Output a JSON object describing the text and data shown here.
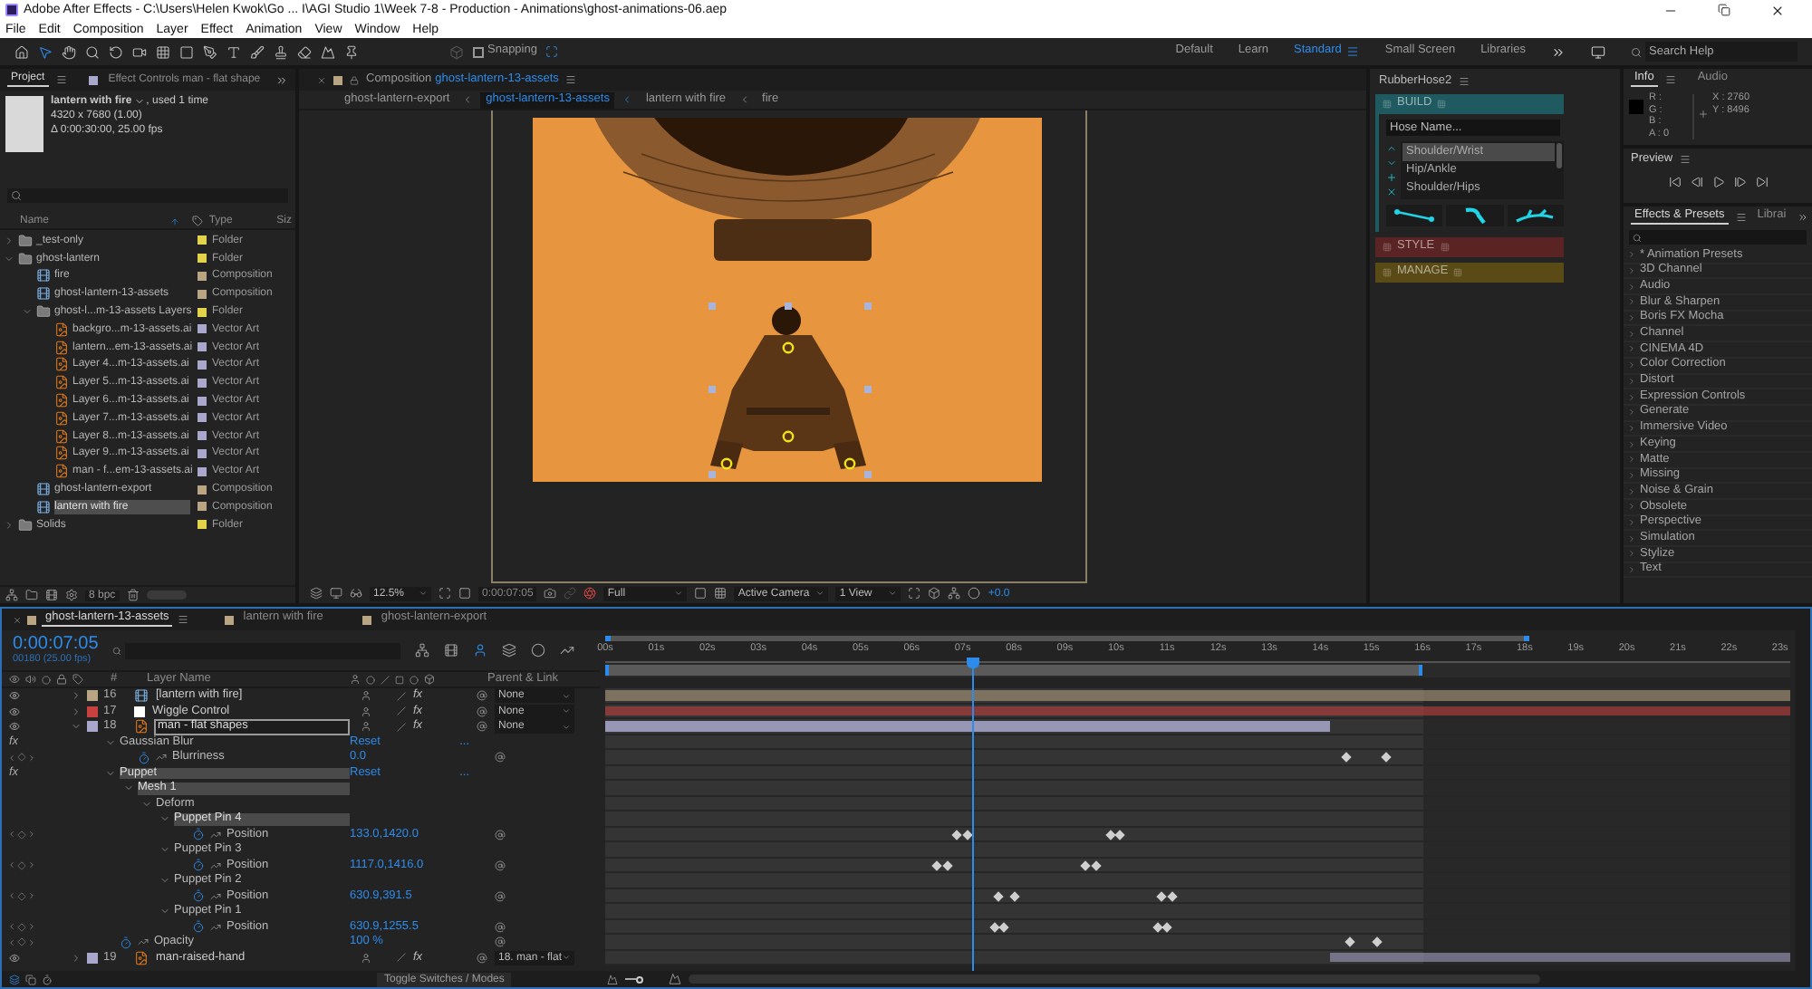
{
  "window": {
    "title": "Adobe After Effects - C:\\Users\\Helen Kwok\\Go ... I\\AGI Studio 1\\Week 7-8 - Production - Animations\\ghost-animations-06.aep"
  },
  "menu": [
    "File",
    "Edit",
    "Composition",
    "Layer",
    "Effect",
    "Animation",
    "View",
    "Window",
    "Help"
  ],
  "toolbar": {
    "snapping": {
      "label": "Snapping",
      "checked": false
    },
    "workspaces": [
      {
        "label": "Default",
        "selected": false
      },
      {
        "label": "Learn",
        "selected": false
      },
      {
        "label": "Standard",
        "selected": true
      },
      {
        "label": "Small Screen",
        "selected": false
      },
      {
        "label": "Libraries",
        "selected": false
      }
    ],
    "search": {
      "placeholder": "Search Help"
    }
  },
  "project": {
    "tabs": [
      {
        "label": "Project",
        "selected": true
      },
      {
        "label": "Effect Controls man - flat shape",
        "selected": false
      }
    ],
    "item": {
      "name": "lantern with fire",
      "used": ", used 1 time",
      "size": "4320 x 7680 (1.00)",
      "duration": "Δ 0:00:30:00, 25.00 fps"
    },
    "columns": [
      "Name",
      "Type",
      "Siz"
    ],
    "items": [
      {
        "name": "_test-only",
        "type": "Folder",
        "kind": "folder",
        "color": "#e3d34b",
        "expanded": false,
        "selected": false
      },
      {
        "name": "ghost-lantern",
        "type": "Folder",
        "kind": "folder",
        "color": "#e3d34b",
        "expanded": true,
        "selected": false,
        "children": [
          {
            "name": "fire",
            "type": "Composition",
            "kind": "comp",
            "color": "#b9a483",
            "selected": false
          },
          {
            "name": "ghost-lantern-13-assets",
            "type": "Composition",
            "kind": "comp",
            "color": "#b9a483",
            "selected": false
          },
          {
            "name": "ghost-l...m-13-assets Layers",
            "type": "Folder",
            "kind": "folder",
            "color": "#e3d34b",
            "expanded": true,
            "selected": false,
            "children": [
              {
                "name": "backgro...m-13-assets.ai",
                "type": "Vector Art",
                "kind": "vector",
                "color": "#a9a8cc",
                "selected": false
              },
              {
                "name": "lantern...em-13-assets.ai",
                "type": "Vector Art",
                "kind": "vector",
                "color": "#a9a8cc",
                "selected": false
              },
              {
                "name": "Layer 4...m-13-assets.ai",
                "type": "Vector Art",
                "kind": "vector",
                "color": "#a9a8cc",
                "selected": false
              },
              {
                "name": "Layer 5...m-13-assets.ai",
                "type": "Vector Art",
                "kind": "vector",
                "color": "#a9a8cc",
                "selected": false
              },
              {
                "name": "Layer 6...m-13-assets.ai",
                "type": "Vector Art",
                "kind": "vector",
                "color": "#a9a8cc",
                "selected": false
              },
              {
                "name": "Layer 7...m-13-assets.ai",
                "type": "Vector Art",
                "kind": "vector",
                "color": "#a9a8cc",
                "selected": false
              },
              {
                "name": "Layer 8...m-13-assets.ai",
                "type": "Vector Art",
                "kind": "vector",
                "color": "#a9a8cc",
                "selected": false
              },
              {
                "name": "Layer 9...m-13-assets.ai",
                "type": "Vector Art",
                "kind": "vector",
                "color": "#a9a8cc",
                "selected": false
              },
              {
                "name": "man - f...em-13-assets.ai",
                "type": "Vector Art",
                "kind": "vector",
                "color": "#a9a8cc",
                "selected": false
              }
            ]
          },
          {
            "name": "ghost-lantern-export",
            "type": "Composition",
            "kind": "comp",
            "color": "#b9a483",
            "selected": false
          },
          {
            "name": "lantern with fire",
            "type": "Composition",
            "kind": "comp",
            "color": "#b9a483",
            "selected": true
          }
        ]
      },
      {
        "name": "Solids",
        "type": "Folder",
        "kind": "folder",
        "color": "#e3d34b",
        "expanded": false,
        "selected": false
      }
    ],
    "bpc": "8 bpc"
  },
  "composition": {
    "label": "Composition",
    "name": "ghost-lantern-13-assets",
    "breadcrumbs": [
      {
        "label": "ghost-lantern-export",
        "selected": false
      },
      {
        "label": "ghost-lantern-13-assets",
        "selected": true
      },
      {
        "label": "lantern with fire",
        "selected": false
      },
      {
        "label": "fire",
        "selected": false
      }
    ],
    "viewer_bar": {
      "zoom": "12.5%",
      "time": "0:00:07:05",
      "resolution": "Full",
      "camera": "Active Camera",
      "views": "1 View",
      "exposure": "+0.0"
    }
  },
  "rubberhose": {
    "title": "RubberHose2",
    "sections": [
      {
        "label": "BUILD",
        "color": "#1f5a60",
        "expanded": true
      },
      {
        "label": "STYLE",
        "color": "#5a2424",
        "expanded": false
      },
      {
        "label": "MANAGE",
        "color": "#5a4a16",
        "expanded": false
      }
    ],
    "hose_name": {
      "placeholder": "Hose Name..."
    },
    "presets": [
      {
        "label": "Shoulder/Wrist",
        "selected": true
      },
      {
        "label": "Hip/Ankle",
        "selected": false
      },
      {
        "label": "Shoulder/Hips",
        "selected": false
      }
    ]
  },
  "info": {
    "tabs": [
      {
        "label": "Info",
        "selected": true
      },
      {
        "label": "Audio",
        "selected": false
      }
    ],
    "channels": [
      "R :",
      "G :",
      "B :",
      "A : 0"
    ],
    "coords": [
      "X : 2760",
      "Y : 8496"
    ]
  },
  "preview": {
    "title": "Preview"
  },
  "effects": {
    "tabs": [
      {
        "label": "Effects & Presets",
        "selected": true
      },
      {
        "label": "Librai",
        "selected": false
      }
    ],
    "items": [
      "* Animation Presets",
      "3D Channel",
      "Audio",
      "Blur & Sharpen",
      "Boris FX Mocha",
      "Channel",
      "CINEMA 4D",
      "Color Correction",
      "Distort",
      "Expression Controls",
      "Generate",
      "Immersive Video",
      "Keying",
      "Matte",
      "Missing",
      "Noise & Grain",
      "Obsolete",
      "Perspective",
      "Simulation",
      "Stylize",
      "Text"
    ]
  },
  "timeline": {
    "tabs": [
      {
        "label": "ghost-lantern-13-assets",
        "selected": true
      },
      {
        "label": "lantern with fire",
        "selected": false
      },
      {
        "label": "ghost-lantern-export",
        "selected": false
      }
    ],
    "current_time": "0:00:07:05",
    "frame": "00180 (25.00 fps)",
    "columns": {
      "number": "#",
      "name": "Layer Name",
      "parent": "Parent & Link"
    },
    "ruler": [
      "00s",
      "01s",
      "02s",
      "03s",
      "04s",
      "05s",
      "06s",
      "07s",
      "08s",
      "09s",
      "10s",
      "11s",
      "12s",
      "13s",
      "14s",
      "15s",
      "16s",
      "17s",
      "18s",
      "19s",
      "20s",
      "21s",
      "22s",
      "23s"
    ],
    "work_area": {
      "level": 0.69
    },
    "zoom": {
      "level": 0.3
    },
    "layers": [
      {
        "number": "16",
        "name": "[lantern with fire]",
        "kind": "comp",
        "color": "#b9a483",
        "fx": "fx",
        "effects_on": true,
        "expanded": false,
        "selected": false,
        "parent": "None",
        "bar": {
          "kind": "leading",
          "level": 1
        }
      },
      {
        "number": "17",
        "name": "Wiggle Control",
        "kind": "solid",
        "color": "#c8413f",
        "fx": "fx",
        "effects_on": true,
        "expanded": false,
        "selected": false,
        "parent": "None",
        "bar": {
          "kind": "leading",
          "level": 1
        }
      },
      {
        "number": "18",
        "name": "man - flat shapes",
        "kind": "vector",
        "color": "#a9a8cc",
        "fx": "fx",
        "effects_on": true,
        "expanded": true,
        "selected": true,
        "parent": "None",
        "bar": {
          "kind": "leading",
          "level": 0.612
        },
        "children": [
          {
            "kind": "effect",
            "fx": "fx",
            "name": "Gaussian Blur",
            "value": "Reset",
            "extra": "...",
            "expanded": true,
            "selected": false,
            "children": [
              {
                "kind": "property",
                "name": "Blurriness",
                "value": "0.0",
                "keyframes": [
                  {
                    "level": 0.625
                  },
                  {
                    "level": 0.659
                  }
                ]
              }
            ]
          },
          {
            "kind": "effect",
            "fx": "fx",
            "name": "Puppet",
            "value": "Reset",
            "extra": "...",
            "expanded": true,
            "selected": true,
            "children": [
              {
                "kind": "group",
                "name": "Mesh 1",
                "expanded": true,
                "selected": true,
                "children": [
                  {
                    "kind": "group",
                    "name": "Deform",
                    "expanded": true,
                    "selected": false,
                    "children": [
                      {
                        "kind": "group",
                        "name": "Puppet Pin 4",
                        "expanded": true,
                        "selected": true,
                        "children": [
                          {
                            "kind": "property",
                            "name": "Position",
                            "value": "133.0,1420.0",
                            "keyframes": [
                              {
                                "level": 0.297
                              },
                              {
                                "level": 0.306
                              },
                              {
                                "level": 0.427
                              },
                              {
                                "level": 0.435
                              }
                            ]
                          }
                        ]
                      },
                      {
                        "kind": "group",
                        "name": "Puppet Pin 3",
                        "expanded": true,
                        "selected": false,
                        "children": [
                          {
                            "kind": "property",
                            "name": "Position",
                            "value": "1117.0,1416.0",
                            "keyframes": [
                              {
                                "level": 0.28
                              },
                              {
                                "level": 0.289
                              },
                              {
                                "level": 0.405
                              },
                              {
                                "level": 0.414
                              }
                            ]
                          }
                        ]
                      },
                      {
                        "kind": "group",
                        "name": "Puppet Pin 2",
                        "expanded": true,
                        "selected": false,
                        "children": [
                          {
                            "kind": "property",
                            "name": "Position",
                            "value": "630.9,391.5",
                            "keyframes": [
                              {
                                "level": 0.332
                              },
                              {
                                "level": 0.345
                              },
                              {
                                "level": 0.47
                              },
                              {
                                "level": 0.478
                              }
                            ]
                          }
                        ]
                      },
                      {
                        "kind": "group",
                        "name": "Puppet Pin 1",
                        "expanded": true,
                        "selected": false,
                        "children": [
                          {
                            "kind": "property",
                            "name": "Position",
                            "value": "630.9,1255.5",
                            "keyframes": [
                              {
                                "level": 0.328
                              },
                              {
                                "level": 0.336
                              },
                              {
                                "level": 0.466
                              },
                              {
                                "level": 0.474
                              }
                            ]
                          }
                        ]
                      }
                    ]
                  }
                ]
              }
            ]
          },
          {
            "kind": "property",
            "name": "Opacity",
            "value": "100 %",
            "keyframes": [
              {
                "level": 0.629
              },
              {
                "level": 0.651
              }
            ]
          }
        ]
      },
      {
        "number": "19",
        "name": "man-raised-hand",
        "kind": "vector",
        "color": "#a9a8cc",
        "fx": "fx",
        "effects_on": true,
        "expanded": false,
        "selected": false,
        "parent": "18. man - flat",
        "bar": {
          "kind": "trailing",
          "level": 0.388
        }
      }
    ],
    "footer": "Toggle Switches / Modes"
  }
}
